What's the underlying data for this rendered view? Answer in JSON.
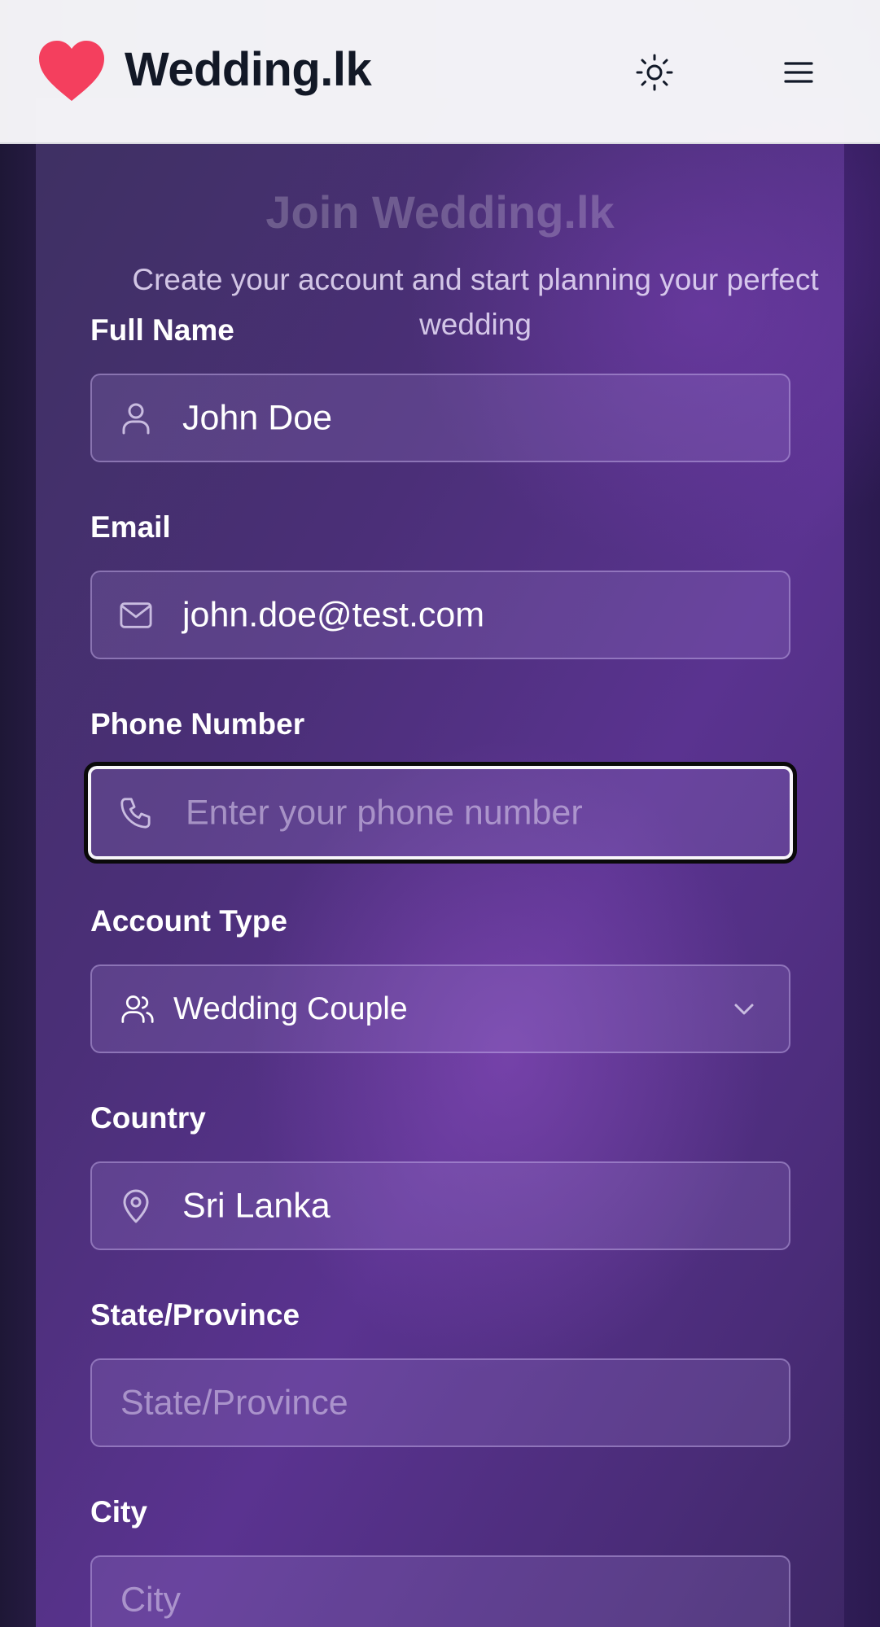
{
  "header": {
    "brand": "Wedding.lk",
    "logo_icon": "heart-icon",
    "theme_toggle_icon": "sun-icon",
    "menu_icon": "hamburger-menu-icon"
  },
  "card": {
    "title_partial": "Join Wedding.lk",
    "subtitle": "Create your account and start planning your perfect wedding"
  },
  "form": {
    "full_name": {
      "label": "Full Name",
      "value": "John Doe",
      "icon": "user-icon"
    },
    "email": {
      "label": "Email",
      "value": "john.doe@test.com",
      "icon": "mail-icon"
    },
    "phone": {
      "label": "Phone Number",
      "placeholder": "Enter your phone number",
      "icon": "phone-icon"
    },
    "account_type": {
      "label": "Account Type",
      "selected": "Wedding Couple",
      "icon": "users-icon"
    },
    "country": {
      "label": "Country",
      "value": "Sri Lanka",
      "icon": "map-pin-icon"
    },
    "state": {
      "label": "State/Province",
      "placeholder": "State/Province"
    },
    "city": {
      "label": "City",
      "placeholder": "City"
    }
  },
  "colors": {
    "brand_heart": "#f43f5e",
    "header_bg": "#f8f8fa",
    "card_bg": "#4b2f78",
    "focus_ring": "#0a0a0a"
  }
}
